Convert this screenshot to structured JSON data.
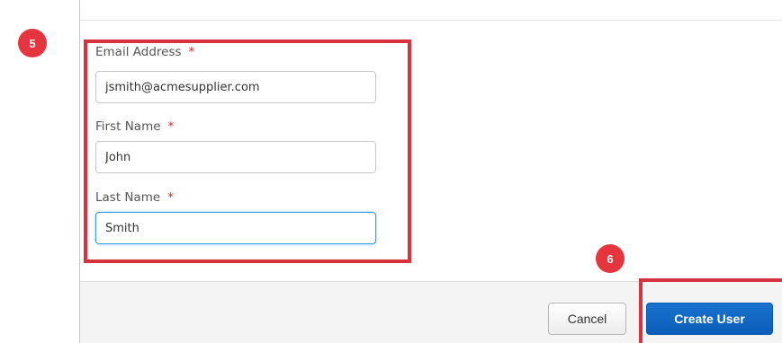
{
  "steps": {
    "form_step": "5",
    "button_step": "6"
  },
  "form": {
    "email": {
      "label": "Email Address",
      "required_mark": "*",
      "value": "jsmith@acmesupplier.com"
    },
    "first_name": {
      "label": "First Name",
      "required_mark": "*",
      "value": "John"
    },
    "last_name": {
      "label": "Last Name",
      "required_mark": "*",
      "value": "Smith"
    }
  },
  "footer": {
    "cancel_label": "Cancel",
    "create_label": "Create User"
  },
  "colors": {
    "highlight": "#d9323f",
    "badge": "#e5363f",
    "primary_button": "#0a5db8",
    "focus_ring": "#3f97e6",
    "required_asterisk": "#d9232e"
  }
}
